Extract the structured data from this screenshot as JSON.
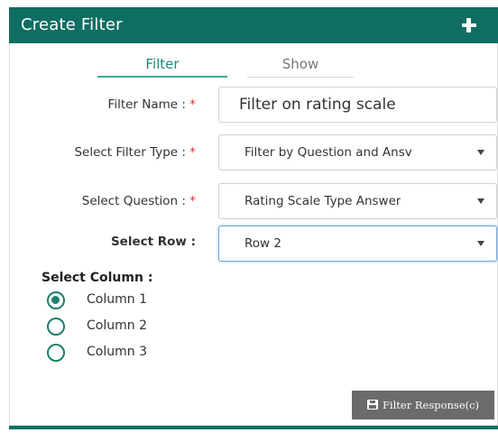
{
  "header": {
    "title": "Create Filter",
    "add_icon": "plus-icon"
  },
  "tabs": [
    {
      "label": "Filter",
      "active": true
    },
    {
      "label": "Show",
      "active": false
    }
  ],
  "form": {
    "filter_name": {
      "label": "Filter Name :",
      "required_mark": "*",
      "value": "Filter on rating scale"
    },
    "filter_type": {
      "label": "Select Filter Type :",
      "required_mark": "*",
      "selected": "Filter by Question and Ansv"
    },
    "question": {
      "label": "Select Question :",
      "required_mark": "*",
      "selected": "Rating Scale Type Answer"
    },
    "row": {
      "label": "Select Row :",
      "selected": "Row 2"
    },
    "column": {
      "label": "Select Column :",
      "options": [
        {
          "label": "Column 1",
          "checked": true
        },
        {
          "label": "Column 2",
          "checked": false
        },
        {
          "label": "Column 3",
          "checked": false
        }
      ]
    }
  },
  "submit": {
    "label": "Filter Response(c)",
    "icon": "floppy-disk-icon"
  },
  "colors": {
    "header": "#0f6e62",
    "accent": "#1d7f6c",
    "required": "#e0302e",
    "button": "#6b6b6b"
  }
}
